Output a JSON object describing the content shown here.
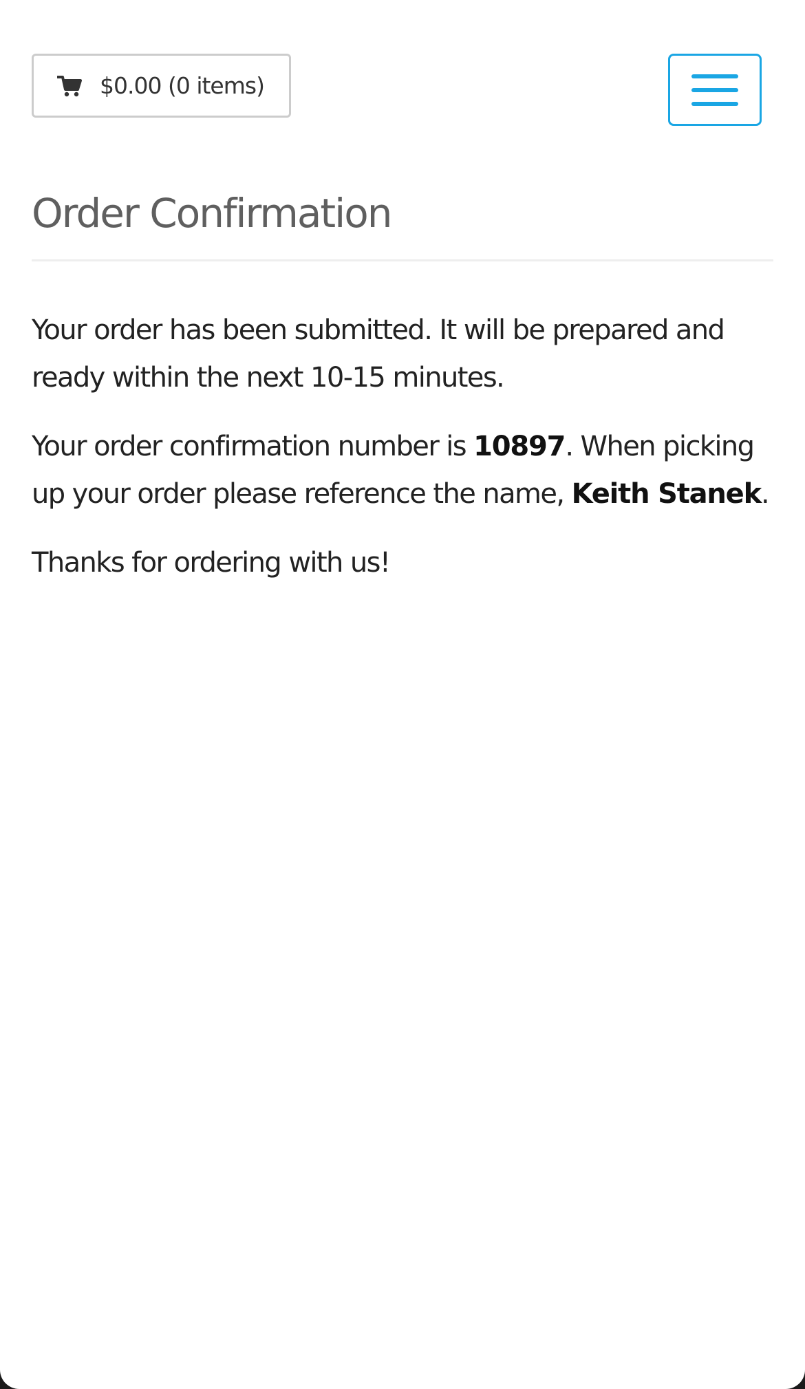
{
  "header": {
    "cart_label": "$0.00 (0 items)",
    "cart_icon": "shopping-cart-icon",
    "menu_icon": "hamburger-menu-icon",
    "accent_color": "#1aa6e4"
  },
  "main": {
    "title": "Order Confirmation",
    "submitted_message": "Your order has been submitted. It will be prepared and ready within the next 10-15 minutes.",
    "confirmation_prefix": "Your order confirmation number is ",
    "confirmation_number": "10897",
    "pickup_text": ". When picking up your order please reference the name, ",
    "customer_name": "Keith Stanek",
    "period": ".",
    "thanks_message": "Thanks for ordering with us!"
  }
}
